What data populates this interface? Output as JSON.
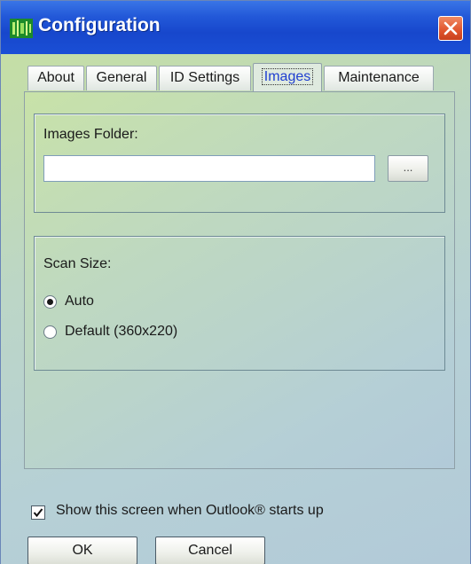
{
  "window": {
    "title": "Configuration",
    "app_icon": "app-icon",
    "close_icon": "close-icon"
  },
  "tabs": [
    {
      "label": "About",
      "active": false
    },
    {
      "label": "General",
      "active": false
    },
    {
      "label": "ID Settings",
      "active": false
    },
    {
      "label": "Images",
      "active": true
    },
    {
      "label": "Maintenance",
      "active": false
    }
  ],
  "images_tab": {
    "folder_label": "Images Folder:",
    "folder_value": "",
    "browse_label": "...",
    "scan_size_label": "Scan Size:",
    "options": [
      {
        "label": "Auto",
        "selected": true
      },
      {
        "label": "Default (360x220)",
        "selected": false
      }
    ]
  },
  "footer": {
    "startup_checkbox_label": "Show this screen when Outlook® starts up",
    "startup_checked": true,
    "ok_label": "OK",
    "cancel_label": "Cancel"
  },
  "colors": {
    "titlebar": "#1747cc",
    "close_button": "#e0542c",
    "active_tab_text": "#1f3fd0"
  }
}
